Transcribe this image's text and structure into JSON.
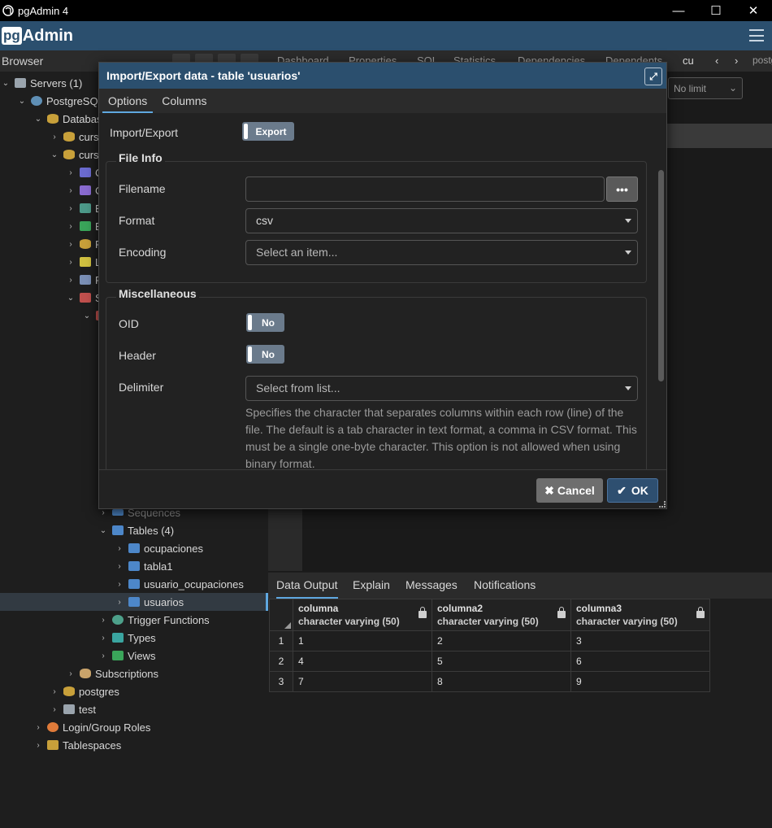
{
  "window": {
    "title": "pgAdmin 4"
  },
  "app": {
    "logo_pg": "pg",
    "logo_admin": "Admin"
  },
  "browser": {
    "title": "Browser"
  },
  "right_tabs": [
    "Dashboard",
    "Properties",
    "SQL",
    "Statistics",
    "Dependencies",
    "Dependents",
    "cu",
    "postgre"
  ],
  "query_limit": "No limit",
  "tree": [
    {
      "label": "Servers (1)"
    },
    {
      "label": "PostgreSQL"
    },
    {
      "label": "Databas"
    },
    {
      "label": "curso"
    },
    {
      "label": "curso"
    },
    {
      "label": "C"
    },
    {
      "label": "C"
    },
    {
      "label": "E"
    },
    {
      "label": "E"
    },
    {
      "label": "F"
    },
    {
      "label": "L"
    },
    {
      "label": "P"
    },
    {
      "label": "S"
    },
    {
      "label": "Sequences"
    },
    {
      "label": "Tables (4)"
    },
    {
      "label": "ocupaciones"
    },
    {
      "label": "tabla1"
    },
    {
      "label": "usuario_ocupaciones"
    },
    {
      "label": "usuarios"
    },
    {
      "label": "Trigger Functions"
    },
    {
      "label": "Types"
    },
    {
      "label": "Views"
    },
    {
      "label": "Subscriptions"
    },
    {
      "label": "postgres"
    },
    {
      "label": "test"
    },
    {
      "label": "Login/Group Roles"
    },
    {
      "label": "Tablespaces"
    }
  ],
  "output_tabs": [
    "Data Output",
    "Explain",
    "Messages",
    "Notifications"
  ],
  "grid": {
    "columns": [
      {
        "name": "columna",
        "type": "character varying (50)"
      },
      {
        "name": "columna2",
        "type": "character varying (50)"
      },
      {
        "name": "columna3",
        "type": "character varying (50)"
      }
    ],
    "rows": [
      {
        "n": "1",
        "cells": [
          "1",
          "2",
          "3"
        ]
      },
      {
        "n": "2",
        "cells": [
          "4",
          "5",
          "6"
        ]
      },
      {
        "n": "3",
        "cells": [
          "7",
          "8",
          "9"
        ]
      }
    ]
  },
  "dialog": {
    "title": "Import/Export data - table 'usuarios'",
    "tabs": [
      "Options",
      "Columns"
    ],
    "import_export_label": "Import/Export",
    "import_export_value": "Export",
    "file_info_legend": "File Info",
    "filename_label": "Filename",
    "filename_value": "",
    "browse_label": "•••",
    "format_label": "Format",
    "format_value": "csv",
    "encoding_label": "Encoding",
    "encoding_placeholder": "Select an item...",
    "misc_legend": "Miscellaneous",
    "oid_label": "OID",
    "oid_value": "No",
    "header_label": "Header",
    "header_value": "No",
    "delimiter_label": "Delimiter",
    "delimiter_placeholder": "Select from list...",
    "delimiter_help": "Specifies the character that separates columns within each row (line) of the file. The default is a tab character in text format, a comma in CSV format. This must be a single one-byte character. This option is not allowed when using binary format.",
    "cancel_label": "Cancel",
    "ok_label": "OK"
  }
}
